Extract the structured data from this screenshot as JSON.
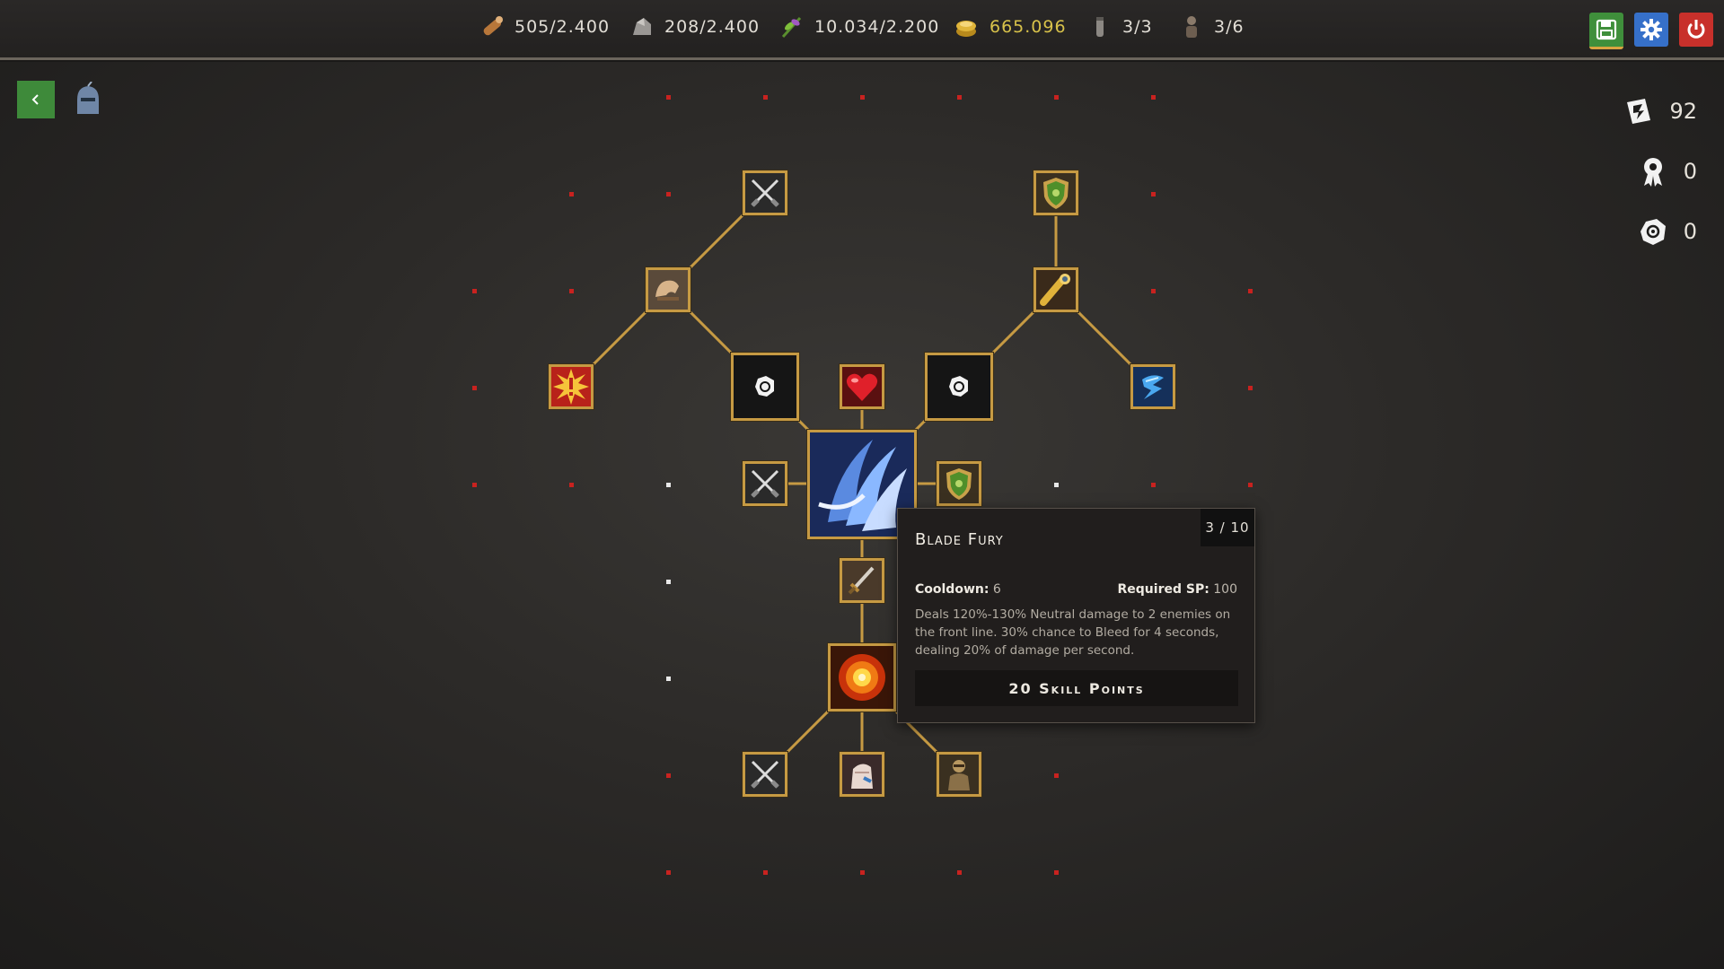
{
  "resources": {
    "wood": {
      "value": "505/2.400",
      "icon": "wood-log-icon"
    },
    "stone": {
      "value": "208/2.400",
      "icon": "stone-icon"
    },
    "herbs": {
      "value": "10.034/2.200",
      "icon": "herb-icon"
    },
    "gold": {
      "value": "665.096",
      "icon": "gold-coins-icon",
      "color": "#d8c24a"
    },
    "elixir": {
      "value": "3/3",
      "icon": "vial-icon"
    },
    "units": {
      "value": "3/6",
      "icon": "unit-figure-icon"
    }
  },
  "system_buttons": [
    "save-icon",
    "gear-icon",
    "power-icon"
  ],
  "counters": {
    "skill_points": "92",
    "medals": "0",
    "essence": "0"
  },
  "tooltip": {
    "title": "Blade Fury",
    "rank": "3 / 10",
    "cooldown_label": "Cooldown:",
    "cooldown_value": "6",
    "required_sp_label": "Required SP:",
    "required_sp_value": "100",
    "description": "Deals 120%-130% Neutral damage to 2 enemies on the front line. 30% chance to Bleed for 4 seconds, dealing 20% of damage per second.",
    "cost": "20 Skill Points"
  },
  "skill_nodes": [
    "crossed-swords-icon",
    "shield-icon",
    "strength-arm-icon",
    "spyglass-icon",
    "alert-burst-icon",
    "chaos-symbol-icon",
    "heart-icon",
    "chaos-symbol-icon",
    "lightning-icon",
    "crossed-swords-icon",
    "blade-fury-icon",
    "shield-icon",
    "sword-icon",
    "explosion-icon",
    "crossed-swords-icon",
    "hand-icon",
    "armored-warrior-icon"
  ],
  "colors": {
    "accent_border": "#c69a43",
    "locked_dot": "#c8221f",
    "open_dot": "#e8e8e8"
  }
}
